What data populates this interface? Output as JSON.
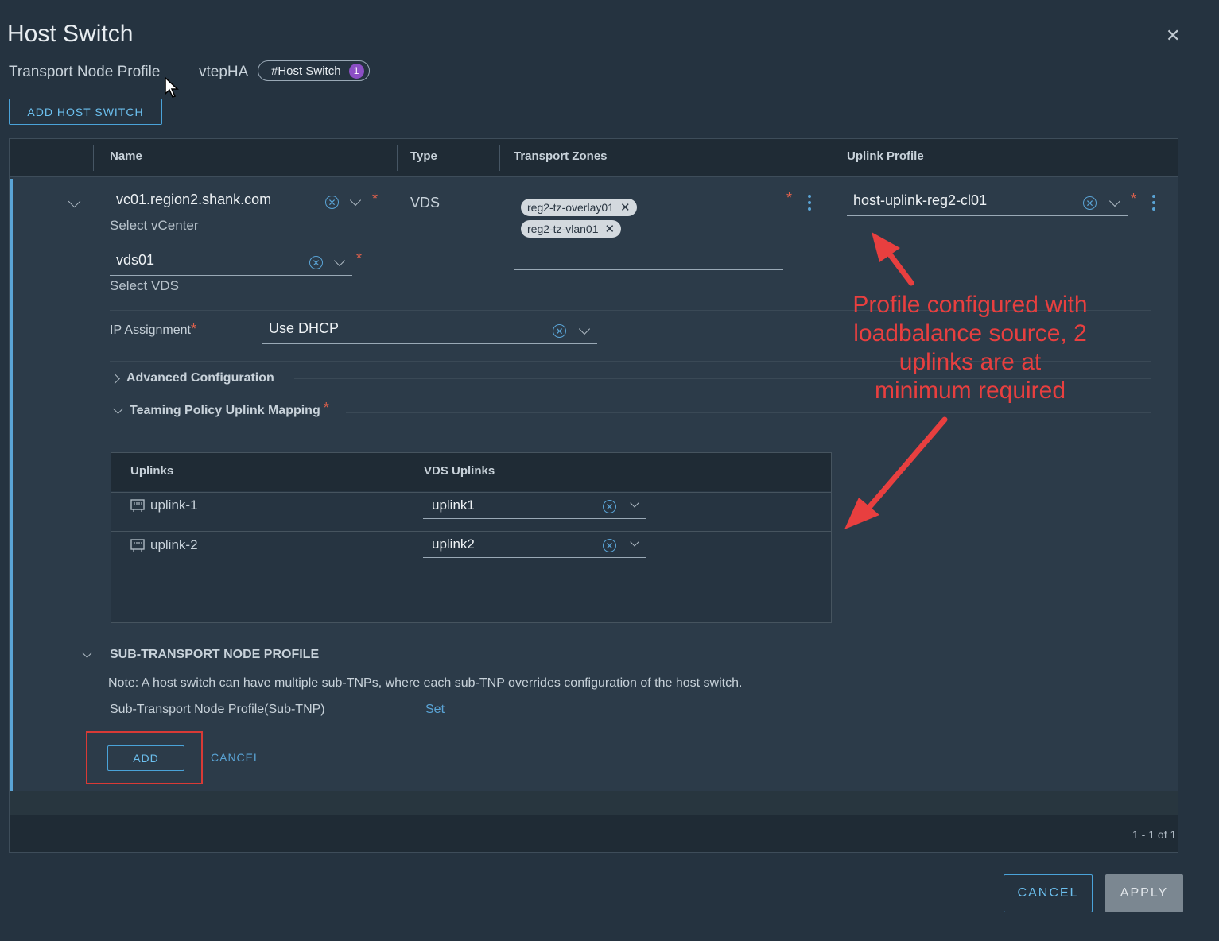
{
  "dialog": {
    "title": "Host Switch",
    "breadcrumb": {
      "profile_label": "Transport Node Profile",
      "profile_name": "vtepHA",
      "tag_label": "#Host Switch",
      "tag_count": "1"
    },
    "add_host_switch_label": "ADD HOST SWITCH",
    "cancel_label": "CANCEL",
    "apply_label": "APPLY"
  },
  "grid": {
    "columns": [
      "Name",
      "Type",
      "Transport Zones",
      "Uplink Profile"
    ],
    "pagination": "1 - 1 of 1"
  },
  "host_switch": {
    "vcenter_value": "vc01.region2.shank.com",
    "vcenter_helper": "Select vCenter",
    "vds_value": "vds01",
    "vds_helper": "Select VDS",
    "type": "VDS",
    "transport_zones": [
      "reg2-tz-overlay01",
      "reg2-tz-vlan01"
    ],
    "uplink_profile_value": "host-uplink-reg2-cl01",
    "ip_assignment_label": "IP Assignment",
    "ip_assignment_value": "Use DHCP",
    "advanced_config_label": "Advanced Configuration",
    "teaming_label": "Teaming Policy Uplink Mapping",
    "mapping_columns": [
      "Uplinks",
      "VDS Uplinks"
    ],
    "mappings": [
      {
        "uplink": "uplink-1",
        "vds_uplink": "uplink1"
      },
      {
        "uplink": "uplink-2",
        "vds_uplink": "uplink2"
      }
    ],
    "sub_tnp_title": "SUB-TRANSPORT NODE PROFILE",
    "sub_tnp_note": "Note: A host switch can have multiple sub-TNPs, where each sub-TNP overrides configuration of the host switch.",
    "sub_tnp_label": "Sub-Transport Node Profile(Sub-TNP)",
    "sub_tnp_link": "Set",
    "add_label": "ADD",
    "row_cancel_label": "CANCEL"
  },
  "annotation": {
    "text": "Profile configured with loadbalance source, 2 uplinks are at minimum required",
    "lines": [
      "Profile configured with",
      "loadbalance source, 2",
      "uplinks are at",
      "minimum required"
    ],
    "color": "#e83f3f"
  },
  "colors": {
    "accent": "#5aa4d6",
    "required": "#e0614c",
    "badge": "#8c4fc5"
  }
}
